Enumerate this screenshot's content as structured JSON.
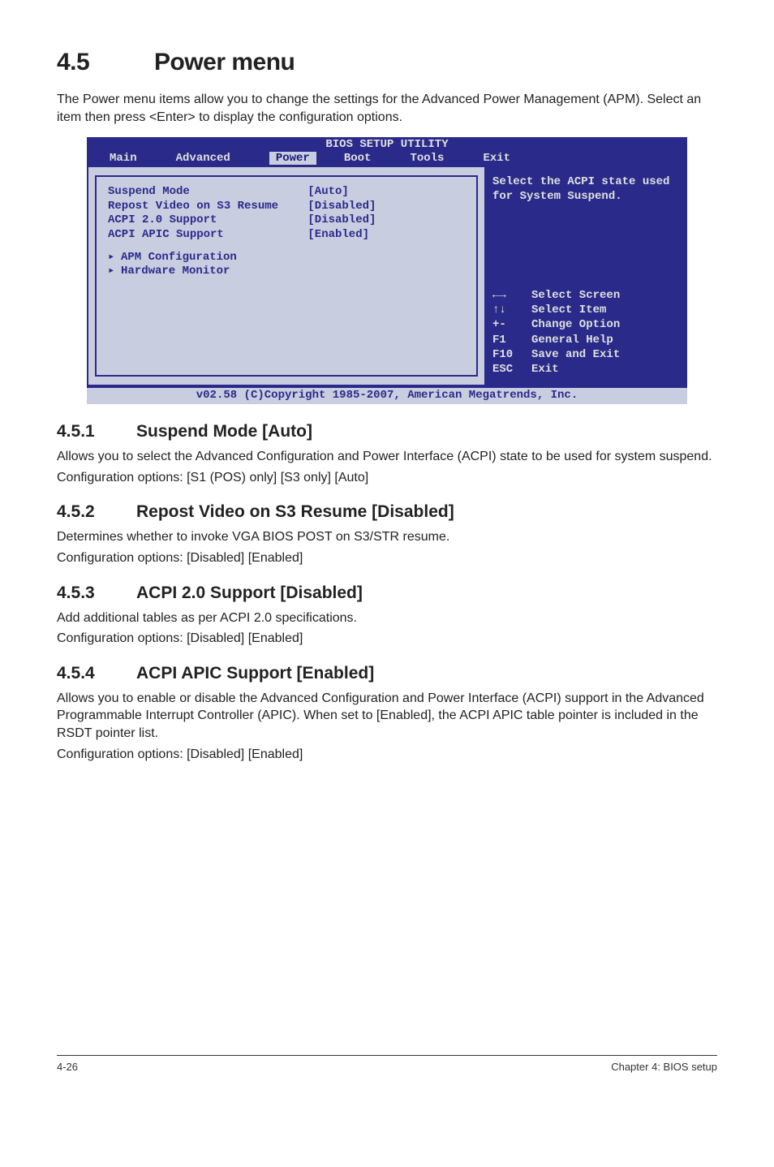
{
  "section": {
    "number": "4.5",
    "title": "Power menu"
  },
  "intro": "The Power menu items allow you to change the settings for the Advanced Power Management (APM). Select an item then press <Enter> to display the configuration options.",
  "bios": {
    "title": "BIOS SETUP UTILITY",
    "tabs": [
      "Main",
      "Advanced",
      "Power",
      "Boot",
      "Tools",
      "Exit"
    ],
    "selected_tab": "Power",
    "items": [
      {
        "label": "Suspend Mode",
        "value": "[Auto]"
      },
      {
        "label": "Repost Video on S3 Resume",
        "value": "[Disabled]"
      },
      {
        "label": "ACPI 2.0 Support",
        "value": "[Disabled]"
      },
      {
        "label": "ACPI APIC Support",
        "value": "[Enabled]"
      }
    ],
    "subs": [
      "APM Configuration",
      "Hardware Monitor"
    ],
    "help_top": "Select the ACPI state used for System Suspend.",
    "keys": [
      {
        "k": "←→",
        "d": "Select Screen"
      },
      {
        "k": "↑↓",
        "d": "Select Item"
      },
      {
        "k": "+-",
        "d": "Change Option"
      },
      {
        "k": "F1",
        "d": "General Help"
      },
      {
        "k": "F10",
        "d": "Save and Exit"
      },
      {
        "k": "ESC",
        "d": "Exit"
      }
    ],
    "footer": "v02.58 (C)Copyright 1985-2007, American Megatrends, Inc."
  },
  "subsections": [
    {
      "num": "4.5.1",
      "title": "Suspend Mode [Auto]",
      "p1": "Allows you to select the Advanced Configuration and Power Interface (ACPI) state to be used for system suspend.",
      "p2": "Configuration options: [S1 (POS) only] [S3 only] [Auto]"
    },
    {
      "num": "4.5.2",
      "title": "Repost Video on S3 Resume [Disabled]",
      "p1": "Determines whether to invoke VGA BIOS POST on S3/STR resume.",
      "p2": "Configuration options: [Disabled] [Enabled]"
    },
    {
      "num": "4.5.3",
      "title": "ACPI 2.0 Support [Disabled]",
      "p1": "Add additional tables as per ACPI 2.0 specifications.",
      "p2": "Configuration options: [Disabled] [Enabled]"
    },
    {
      "num": "4.5.4",
      "title": "ACPI APIC Support [Enabled]",
      "p1": "Allows you to enable or disable the Advanced Configuration and Power Interface (ACPI) support in the Advanced Programmable Interrupt Controller (APIC). When set to [Enabled], the ACPI APIC table pointer is included in the RSDT pointer list.",
      "p2": "Configuration options: [Disabled] [Enabled]"
    }
  ],
  "footer": {
    "left": "4-26",
    "right": "Chapter 4: BIOS setup"
  }
}
